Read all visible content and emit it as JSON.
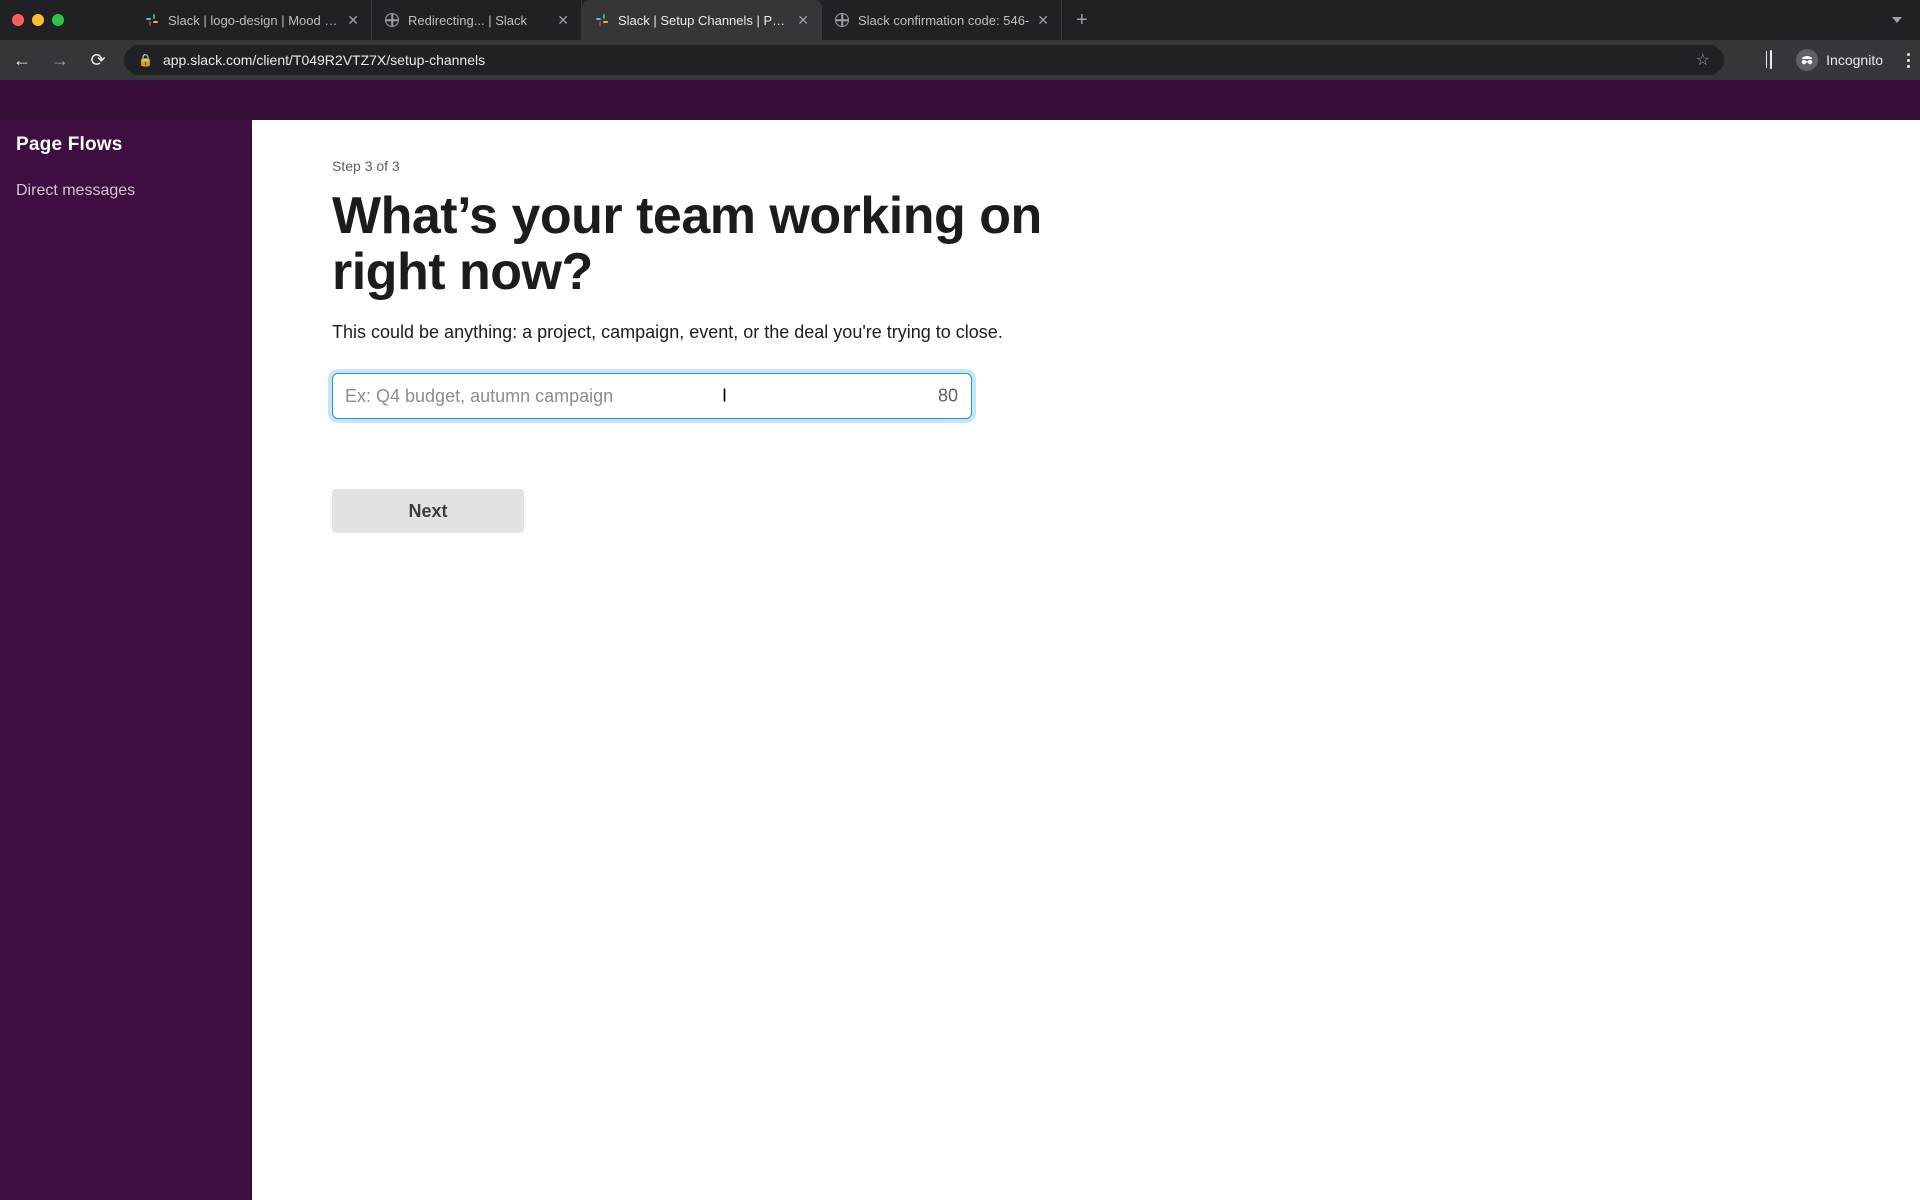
{
  "browser": {
    "tabs": [
      {
        "title": "Slack | logo-design | Mood Joy",
        "favicon": "slack"
      },
      {
        "title": "Redirecting... | Slack",
        "favicon": "globe"
      },
      {
        "title": "Slack | Setup Channels | Page",
        "favicon": "slack",
        "active": true
      },
      {
        "title": "Slack confirmation code: 546-",
        "favicon": "globe"
      }
    ],
    "url": "app.slack.com/client/T049R2VTZ7X/setup-channels",
    "incognito_label": "Incognito"
  },
  "sidebar": {
    "workspace": "Page Flows",
    "items": [
      {
        "label": "Direct messages"
      }
    ]
  },
  "main": {
    "step_label": "Step 3 of 3",
    "heading": "What’s your team working on right now?",
    "subtext": "This could be anything: a project, campaign, event, or the deal you're trying to close.",
    "input_placeholder": "Ex: Q4 budget, autumn campaign",
    "input_value": "",
    "char_count": "80",
    "next_label": "Next"
  },
  "colors": {
    "slack_purple": "#3F0E40",
    "slack_top": "#340E36",
    "focus_ring": "#1d9bd1"
  }
}
